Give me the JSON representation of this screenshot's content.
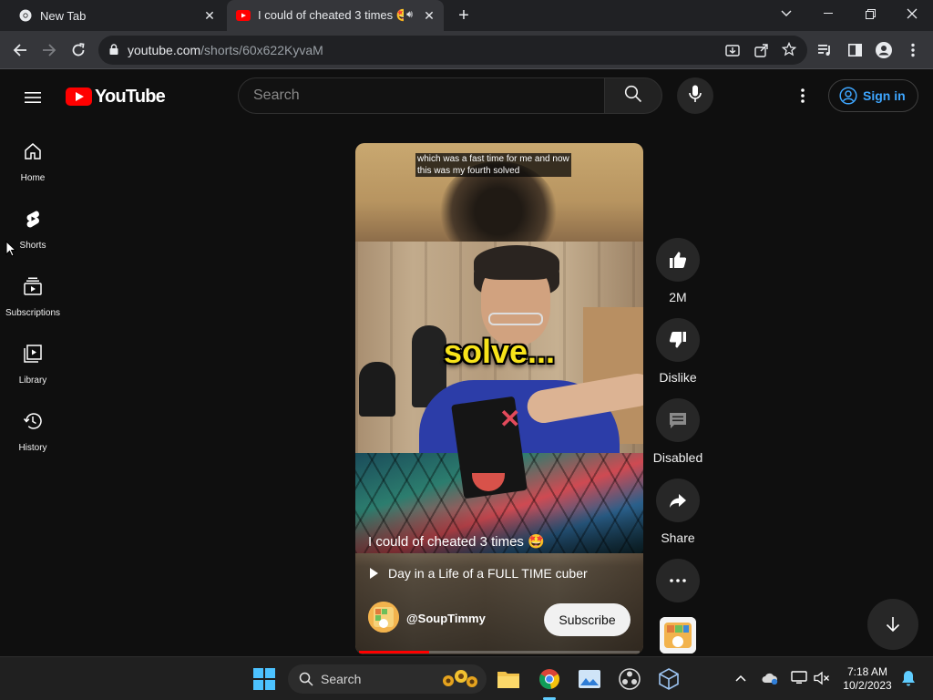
{
  "browser": {
    "tabs": [
      {
        "title": "New Tab"
      },
      {
        "title": "I could of cheated 3 times 🤩"
      }
    ],
    "url_host": "youtube.com",
    "url_path": "/shorts/60x622KyvaM"
  },
  "header": {
    "logo_text": "YouTube",
    "search_placeholder": "Search",
    "sign_in_label": "Sign in"
  },
  "sidebar": {
    "items": [
      {
        "label": "Home"
      },
      {
        "label": "Shorts"
      },
      {
        "label": "Subscriptions"
      },
      {
        "label": "Library"
      },
      {
        "label": "History"
      }
    ]
  },
  "short": {
    "caption_line1": "which was a fast time for me and now",
    "caption_line2": "this was my fourth solved",
    "overlay_word": "solve...",
    "title": "I could of cheated 3 times 🤩",
    "playlist": "Day in a Life of a FULL TIME cuber",
    "channel": "@SoupTimmy",
    "subscribe_label": "Subscribe",
    "progress_fraction": 0.25
  },
  "actions": {
    "like_count": "2M",
    "dislike_label": "Dislike",
    "comments_label": "Disabled",
    "share_label": "Share"
  },
  "taskbar": {
    "search_label": "Search",
    "time": "7:18 AM",
    "date": "10/2/2023"
  },
  "colors": {
    "youtube_red": "#ff0000",
    "link_blue": "#3ea6ff",
    "caption_yellow": "#f7e31a"
  }
}
